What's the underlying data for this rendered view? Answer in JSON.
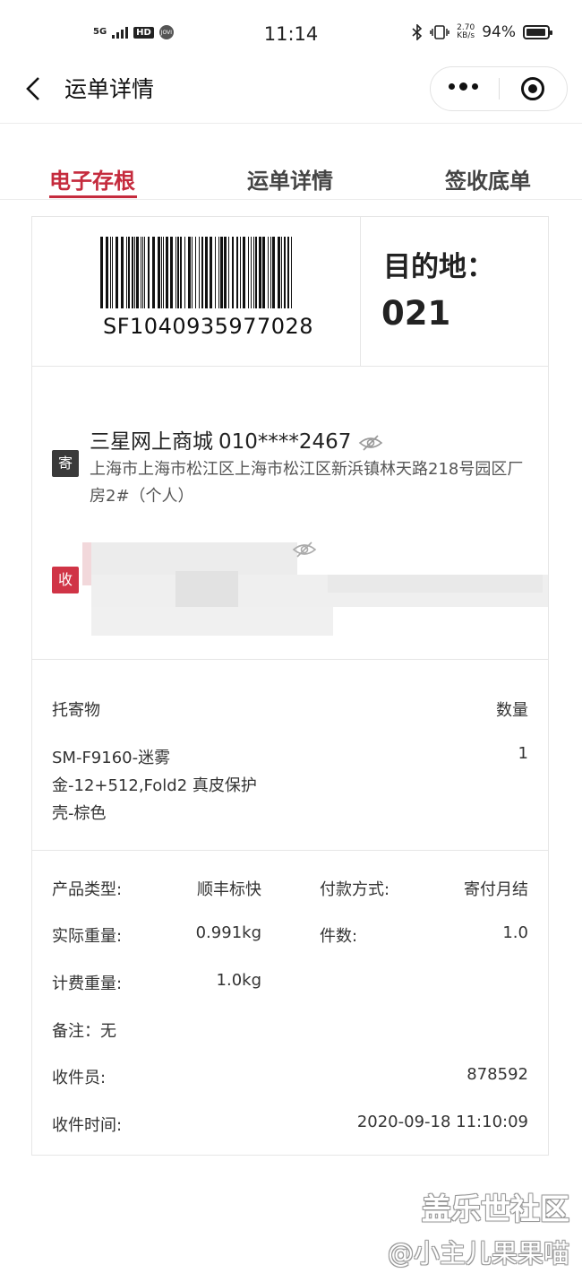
{
  "status_bar": {
    "network": "5G",
    "hd": "HD",
    "jovi": "JOVI",
    "time": "11:14",
    "speed_value": "2.70",
    "speed_unit": "KB/s",
    "battery_text": "94%",
    "battery_level": 0.94,
    "icons": [
      "bluetooth-icon",
      "vibrate-icon",
      "battery-icon"
    ]
  },
  "nav": {
    "title": "运单详情",
    "back_icon": "chevron-left-icon",
    "more_icon": "more-dots-icon",
    "close_icon": "target-circle-icon"
  },
  "tabs": [
    {
      "label": "电子存根",
      "active": true
    },
    {
      "label": "运单详情",
      "active": false
    },
    {
      "label": "签收底单",
      "active": false
    }
  ],
  "waybill": {
    "number": "SF1040935977028",
    "dest_label": "目的地：",
    "dest_code": "021"
  },
  "sender": {
    "badge": "寄",
    "name": "三星网上商城",
    "phone": "010****2467",
    "address": "上海市上海市松江区上海市松江区新浜镇林天路218号园区厂房2#（个人）"
  },
  "receiver": {
    "badge": "收"
  },
  "goods": {
    "header_item": "托寄物",
    "header_qty": "数量",
    "item": "SM-F9160-迷雾金-12+512,Fold2 真皮保护壳-棕色",
    "qty": "1"
  },
  "info": {
    "product_type_label": "产品类型:",
    "product_type": "顺丰标快",
    "payment_label": "付款方式:",
    "payment": "寄付月结",
    "actual_weight_label": "实际重量:",
    "actual_weight": "0.991kg",
    "pieces_label": "件数:",
    "pieces": "1.0",
    "billing_weight_label": "计费重量:",
    "billing_weight": "1.0kg",
    "remark": "备注：无",
    "courier_label": "收件员:",
    "courier": "878592",
    "pickup_time_label": "收件时间:",
    "pickup_time": "2020-09-18 11:10:09"
  },
  "watermark": {
    "line1": "盖乐世社区",
    "line2": "@小主儿果果喵"
  },
  "colors": {
    "accent": "#c52b3d",
    "receiver_badge": "#d03446",
    "sender_badge": "#3a3a3a"
  }
}
